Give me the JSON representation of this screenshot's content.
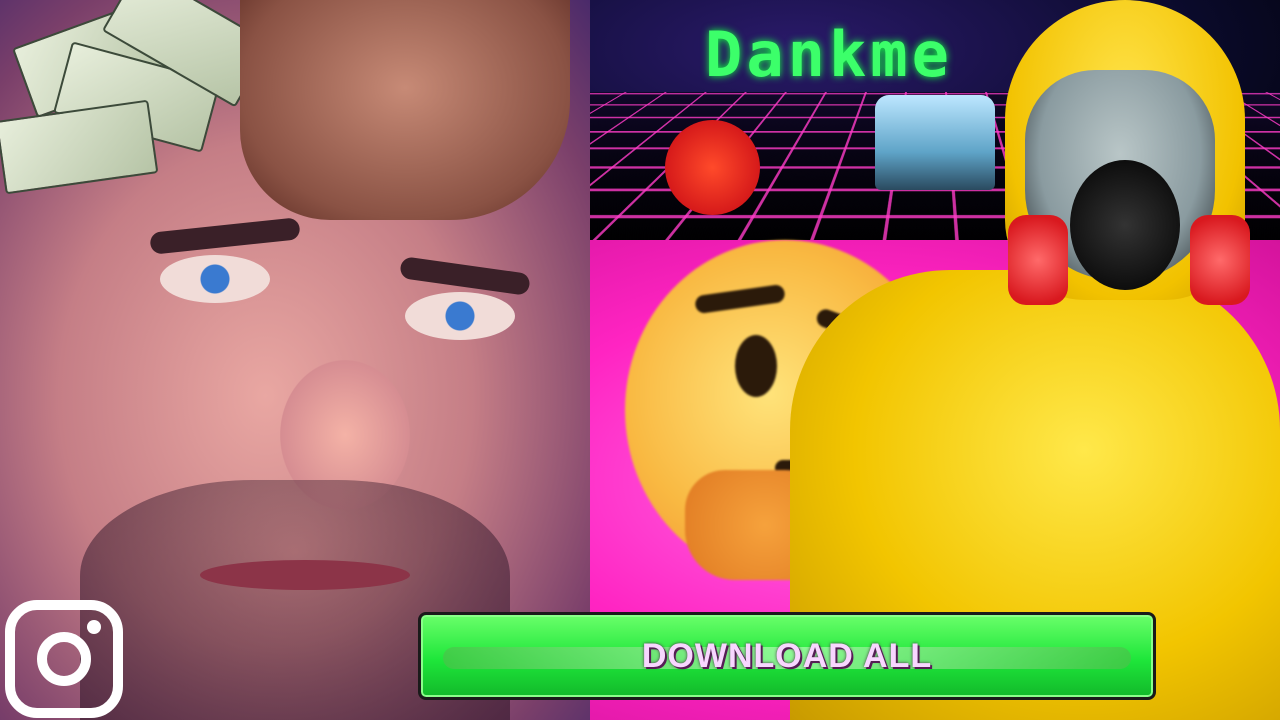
{
  "banner": {
    "title": "Dankme"
  },
  "download_button": {
    "label": "DOWNLOAD ALL"
  },
  "icons": {
    "social": "instagram-icon",
    "app": "reddit-icon",
    "emoji": "thinking-face-emoji"
  },
  "colors": {
    "background": "#ff2bd0",
    "banner_title": "#3cff6a",
    "button": "#1ee63a",
    "suit": "#f2c500"
  }
}
